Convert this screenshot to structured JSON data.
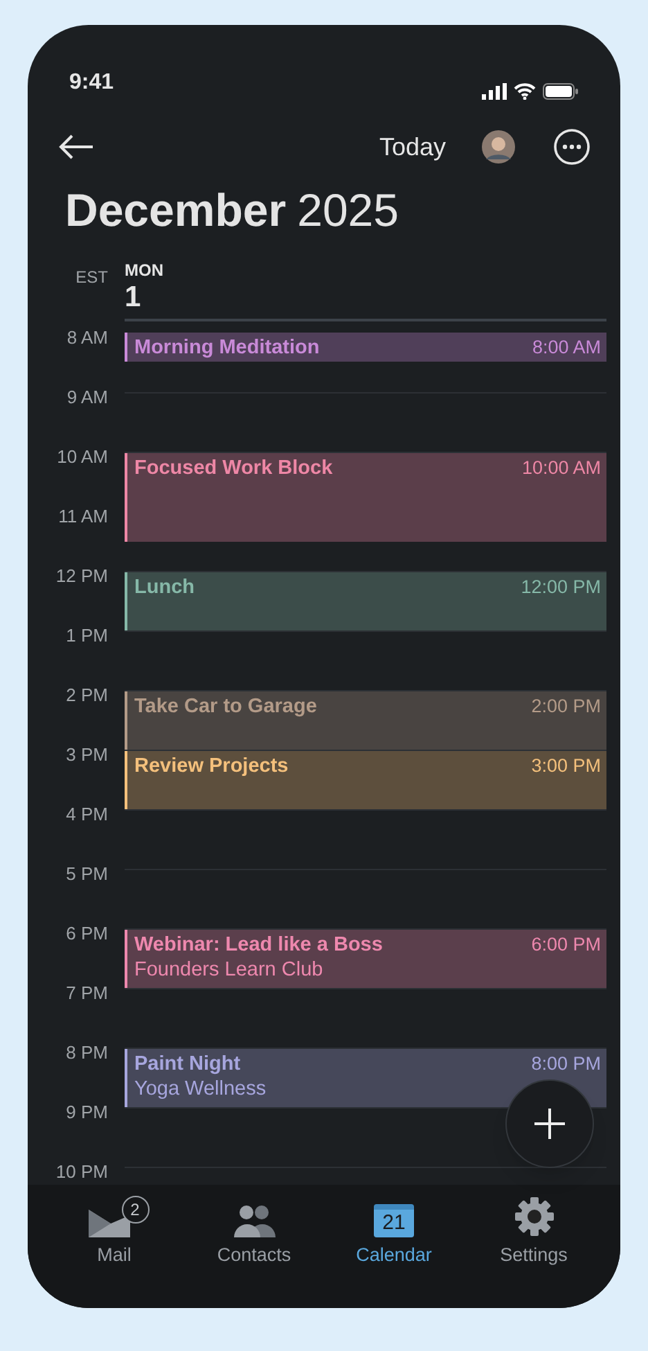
{
  "status_bar": {
    "time": "9:41"
  },
  "header": {
    "today_button": "Today",
    "month": "December",
    "year": "2025"
  },
  "day_header": {
    "timezone": "EST",
    "weekday": "MON",
    "day": "1"
  },
  "hours": [
    {
      "label": "8 AM",
      "events": [
        {
          "title": "Morning Meditation",
          "time": "8:00 AM",
          "color": "#c98ad8",
          "kind": "short"
        }
      ]
    },
    {
      "label": "9 AM"
    },
    {
      "label": "10 AM",
      "events": [
        {
          "title": "Focused Work Block",
          "time": "10:00 AM",
          "color": "#ee87a6",
          "kind": "long"
        }
      ]
    },
    {
      "label": "11 AM"
    },
    {
      "label": "12 PM",
      "events": [
        {
          "title": "Lunch",
          "time": "12:00 PM",
          "color": "#86b8a8",
          "kind": "standard"
        }
      ]
    },
    {
      "label": "1 PM"
    },
    {
      "label": "2 PM",
      "events": [
        {
          "title": "Take Car to Garage",
          "time": "2:00 PM",
          "color": "#b39b88",
          "kind": "standard"
        }
      ]
    },
    {
      "label": "3 PM",
      "events": [
        {
          "title": "Review Projects",
          "time": "3:00 PM",
          "color": "#f4c07c",
          "kind": "standard"
        }
      ]
    },
    {
      "label": "4 PM"
    },
    {
      "label": "5 PM"
    },
    {
      "label": "6 PM",
      "events": [
        {
          "title": "Webinar: Lead like a Boss",
          "subtitle": "Founders Learn Club",
          "time": "6:00 PM",
          "color": "#ee88ae",
          "kind": "standard"
        }
      ]
    },
    {
      "label": "7 PM"
    },
    {
      "label": "8 PM",
      "events": [
        {
          "title": "Paint Night",
          "subtitle": "Yoga Wellness",
          "time": "8:00 PM",
          "color": "#a7a6de",
          "kind": "standard"
        }
      ]
    },
    {
      "label": "9 PM"
    },
    {
      "label": "10 PM"
    }
  ],
  "tab_bar": [
    {
      "kind": "mail",
      "label": "Mail",
      "badge": "2",
      "selected": false
    },
    {
      "kind": "contacts",
      "label": "Contacts",
      "selected": false
    },
    {
      "kind": "calendar",
      "label": "Calendar",
      "icon_text": "21",
      "selected": true
    },
    {
      "kind": "settings",
      "label": "Settings",
      "selected": false
    }
  ]
}
